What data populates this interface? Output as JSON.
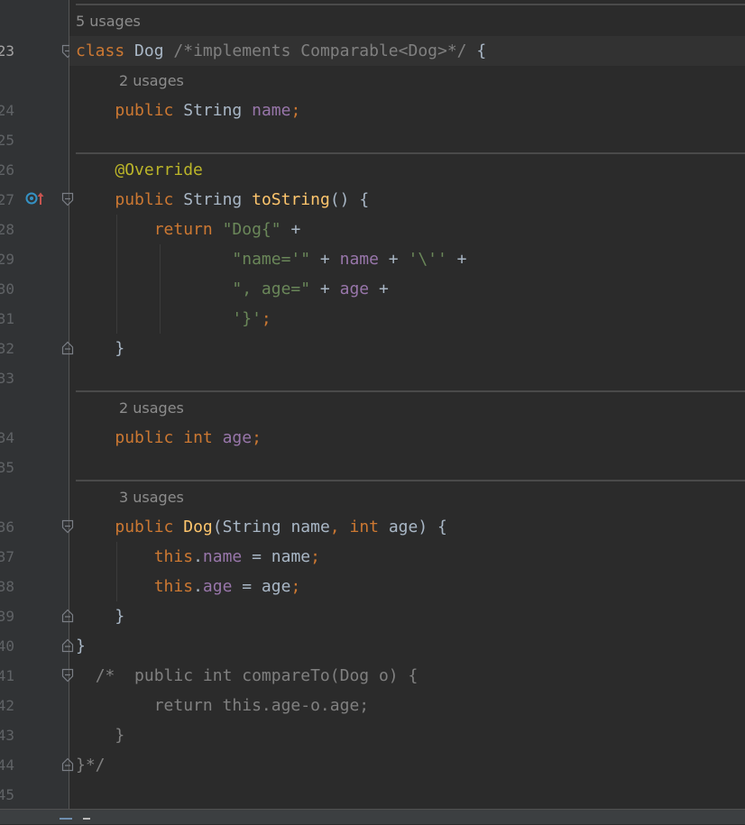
{
  "editor": {
    "line_numbers": [
      "23",
      "24",
      "25",
      "26",
      "27",
      "28",
      "29",
      "30",
      "31",
      "32",
      "33",
      "34",
      "35",
      "36",
      "37",
      "38",
      "39",
      "40",
      "41",
      "42",
      "43",
      "44",
      "45"
    ],
    "usages": {
      "class": "5 usages",
      "name_field": "2 usages",
      "age_field": "2 usages",
      "constructor": "3 usages"
    },
    "code": {
      "l23": {
        "kw": "class",
        "name": "Dog",
        "comment": "/*implements Comparable<Dog>*/",
        "brace": "{"
      },
      "l24": {
        "kw": "public",
        "type": "String",
        "field": "name",
        "semi": ";"
      },
      "l26": {
        "annotation": "@Override"
      },
      "l27": {
        "kw": "public",
        "type": "String",
        "method": "toString",
        "rest": "() {"
      },
      "l28": {
        "kw": "return",
        "str": "\"Dog{\"",
        "rest": " +"
      },
      "l29": {
        "str1": "\"name='\"",
        "op1": " + ",
        "field": "name",
        "op2": " + ",
        "str2": "'\\''",
        "op3": " +"
      },
      "l30": {
        "str1": "\", age=\"",
        "op1": " + ",
        "field": "age",
        "op2": " +"
      },
      "l31": {
        "str": "'}'",
        "semi": ";"
      },
      "l32": {
        "text": "}"
      },
      "l34": {
        "kw": "public",
        "type": "int",
        "field": "age",
        "semi": ";"
      },
      "l36": {
        "kw": "public",
        "ctor": "Dog",
        "p1": "(String name",
        "comma": ",",
        "kw2": "int",
        "p2": "age) {"
      },
      "l37": {
        "kw": "this",
        "dot": ".",
        "field": "name",
        "rest": " = name",
        "semi": ";"
      },
      "l38": {
        "kw": "this",
        "dot": ".",
        "field": "age",
        "rest": " = age",
        "semi": ";"
      },
      "l39": {
        "text": "}"
      },
      "l40": {
        "text": "}"
      },
      "l41": {
        "text": "/*  public int compareTo(Dog o) {"
      },
      "l42": {
        "text": "return this.age-o.age;"
      },
      "l43": {
        "text": "}"
      },
      "l44": {
        "text": "}*/"
      }
    },
    "gutter_icon": "override-method-icon",
    "colors": {
      "background": "#2b2b2b",
      "keyword": "#cc7832",
      "string": "#6a8759",
      "field": "#9876aa",
      "method": "#ffc66d",
      "annotation": "#bbb529",
      "comment": "#808080"
    }
  }
}
